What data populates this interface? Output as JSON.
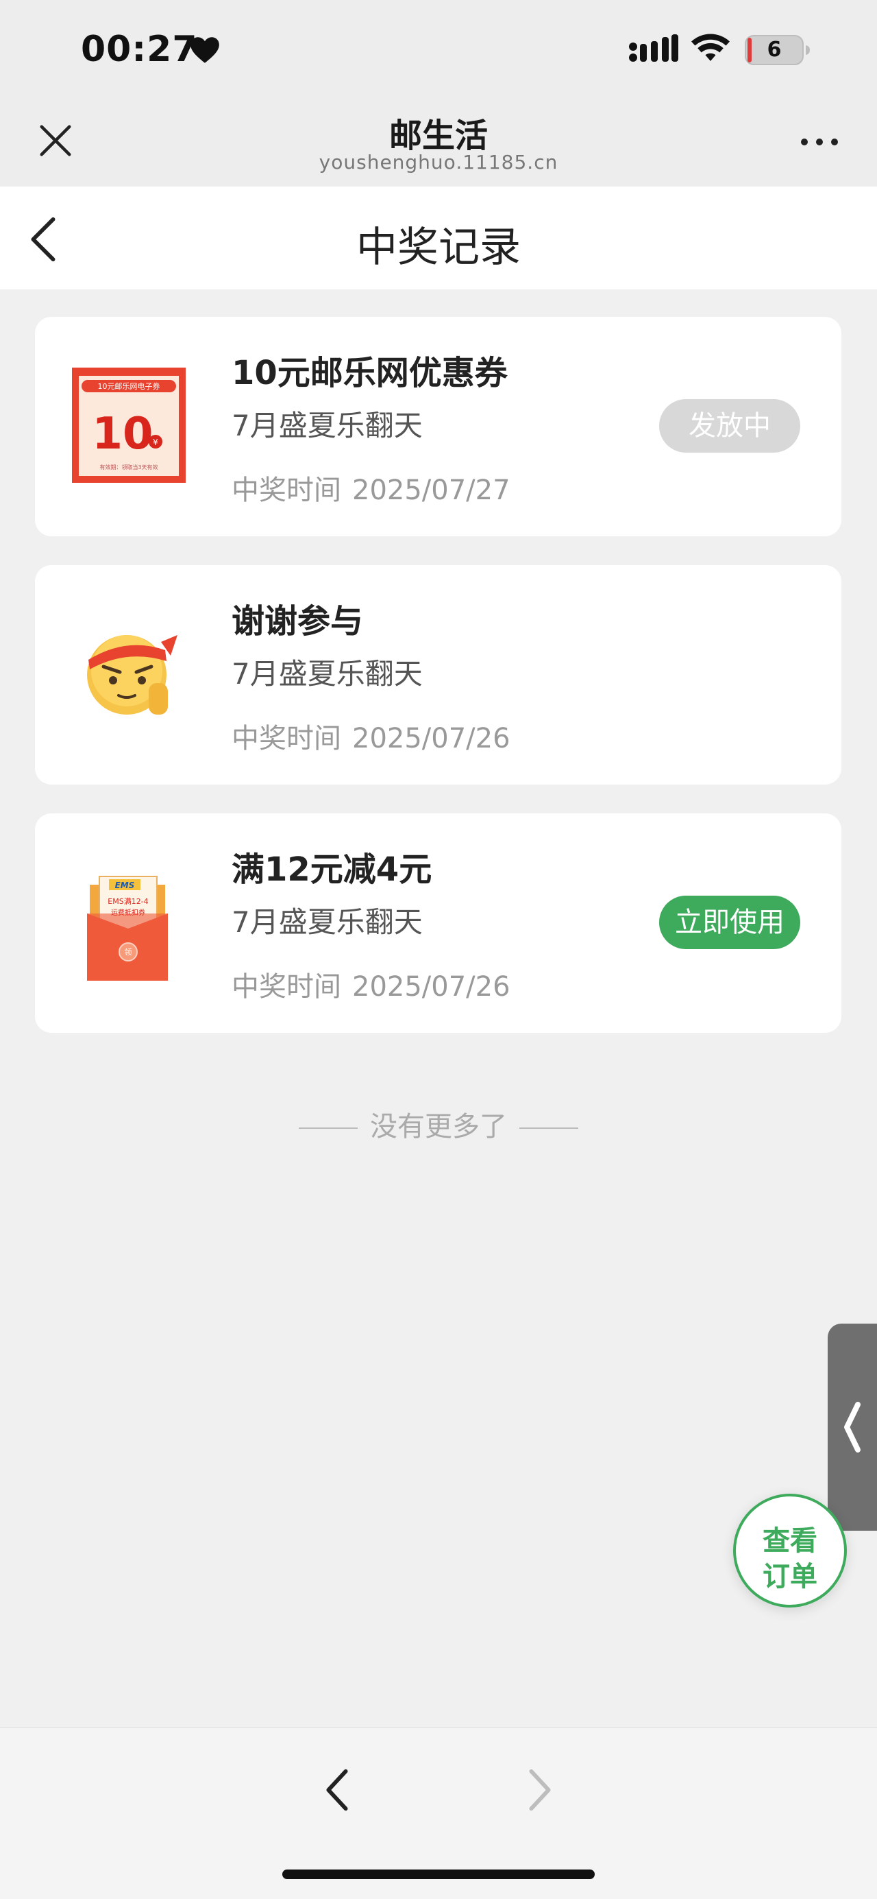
{
  "status_bar": {
    "time": "00:27",
    "battery": "6"
  },
  "browser": {
    "site_title": "邮生活",
    "site_url": "youshenghuo.11185.cn"
  },
  "page": {
    "title": "中奖记录"
  },
  "records": [
    {
      "name": "10元邮乐网优惠券",
      "activity": "7月盛夏乐翻天",
      "time_label": "中奖时间",
      "date": "2025/07/27",
      "status": "发放中",
      "image_text": {
        "banner": "10元邮乐网电子券",
        "amount": "10",
        "currency": "¥",
        "footer": "有效期：领取当3天有效"
      }
    },
    {
      "name": "谢谢参与",
      "activity": "7月盛夏乐翻天",
      "time_label": "中奖时间",
      "date": "2025/07/26"
    },
    {
      "name": "满12元减4元",
      "activity": "7月盛夏乐翻天",
      "time_label": "中奖时间",
      "date": "2025/07/26",
      "status": "立即使用",
      "image_text": {
        "brand": "EMS",
        "coupon": "EMS满12-4",
        "coupon_type": "运费抵扣券",
        "seal": "领"
      }
    }
  ],
  "list_end": "没有更多了",
  "floating": {
    "order_line1": "查看",
    "order_line2": "订单"
  },
  "colors": {
    "accent_green": "#3daa5c",
    "pending_gray": "#d8d8d8",
    "background": "#f0f0f0"
  }
}
